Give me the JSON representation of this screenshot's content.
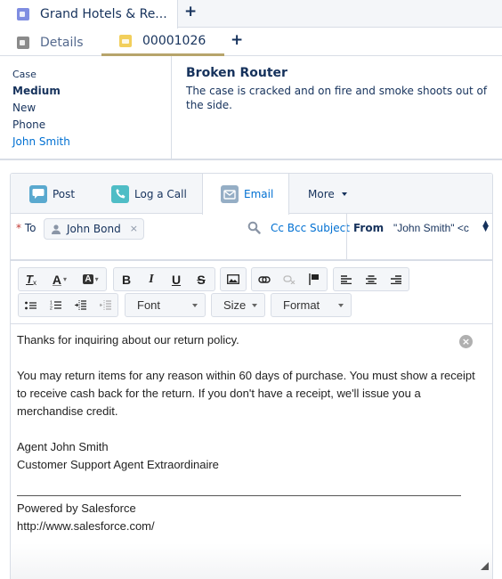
{
  "workspace_tabs": {
    "active": {
      "label": "Grand Hotels & Re...",
      "icon": "account-icon"
    },
    "new_tab_icon": "+"
  },
  "subtabs": {
    "details": {
      "label": "Details",
      "icon": "details-icon"
    },
    "case": {
      "label": "00001026",
      "icon": "case-icon"
    },
    "new_subtab_icon": "+"
  },
  "case_summary": {
    "type": "Case",
    "priority": "Medium",
    "status": "New",
    "origin": "Phone",
    "contact": "John Smith",
    "subject": "Broken Router",
    "description": "The case is cracked and on fire and smoke shoots out of the side."
  },
  "publisher": {
    "tabs": [
      {
        "label": "Post",
        "icon": "chat-icon"
      },
      {
        "label": "Log a Call",
        "icon": "phone-icon"
      },
      {
        "label": "Email",
        "icon": "email-icon",
        "active": true
      },
      {
        "label": "More",
        "icon": "chevron-down-icon"
      }
    ],
    "to_label": "To",
    "required_marker": "*",
    "recipient": "John Bond",
    "remove_recipient": "×",
    "cc_bcc_subject": "Cc Bcc Subject",
    "from_label": "From",
    "from_value": "\"John Smith\" <c",
    "colors": {
      "accent": "#0070d2",
      "required": "#c23934",
      "active_tab_underline": "#b7a46b"
    }
  },
  "toolbar": {
    "font_select": "Font",
    "size_select": "Size",
    "format_select": "Format",
    "buttons": [
      "remove-format",
      "text-color",
      "background-color",
      "bold",
      "italic",
      "underline",
      "strikethrough",
      "image",
      "link",
      "unlink",
      "anchor",
      "align-left",
      "align-center",
      "align-right",
      "bulleted-list",
      "numbered-list",
      "indent",
      "outdent"
    ]
  },
  "editor": {
    "clear_icon": "×",
    "lines": {
      "l1": "Thanks for inquiring about our return policy.",
      "l2": "You may return items for any reason within 60 days of purchase. You must show a receipt to receive cash back for the return. If you don't have a receipt, we'll issue you a merchandise credit.",
      "l3": "Agent John Smith",
      "l4": "Customer Support Agent Extraordinaire",
      "l5": "Powered by Salesforce",
      "l6": "http://www.salesforce.com/"
    }
  }
}
